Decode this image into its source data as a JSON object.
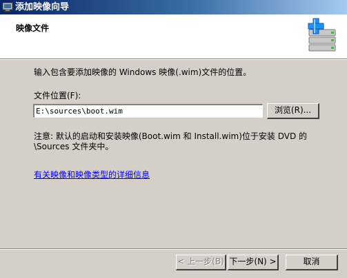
{
  "window": {
    "title": "添加映像向导",
    "icon": "monitor-icon"
  },
  "header": {
    "title": "映像文件",
    "icon": "add-image-wizard-icon"
  },
  "content": {
    "instruction": "输入包含要添加映像的 Windows 映像(.wim)文件的位置。",
    "file_location_label": "文件位置(F):",
    "file_path_value": "E:\\sources\\boot.wim",
    "browse_label": "浏览(R)...",
    "note_line1": "注意: 默认的启动和安装映像(Boot.wim 和 Install.wim)位于安装 DVD 的",
    "note_line2": "\\Sources 文件夹中。",
    "help_link": "有关映像和映像类型的详细信息"
  },
  "footer": {
    "back_label": "< 上一步(B)",
    "next_label": "下一步(N) >",
    "cancel_label": "取消"
  },
  "colors": {
    "title_bar": "#0a246a",
    "dialog_bg": "#d4d0c8",
    "link": "#0000ff",
    "icon_plus": "#1e90ff"
  }
}
